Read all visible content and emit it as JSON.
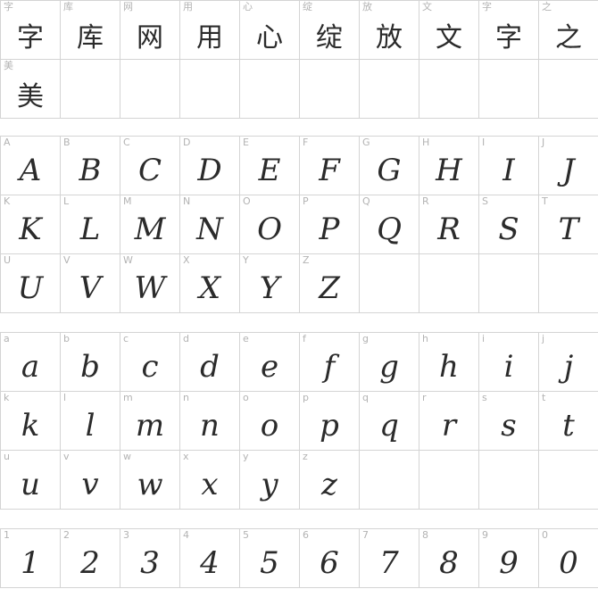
{
  "sections": {
    "cjk": [
      "字",
      "库",
      "网",
      "用",
      "心",
      "绽",
      "放",
      "文",
      "字",
      "之",
      "美"
    ],
    "upper": [
      "A",
      "B",
      "C",
      "D",
      "E",
      "F",
      "G",
      "H",
      "I",
      "J",
      "K",
      "L",
      "M",
      "N",
      "O",
      "P",
      "Q",
      "R",
      "S",
      "T",
      "U",
      "V",
      "W",
      "X",
      "Y",
      "Z"
    ],
    "lower": [
      "a",
      "b",
      "c",
      "d",
      "e",
      "f",
      "g",
      "h",
      "i",
      "j",
      "k",
      "l",
      "m",
      "n",
      "o",
      "p",
      "q",
      "r",
      "s",
      "t",
      "u",
      "v",
      "w",
      "x",
      "y",
      "z"
    ],
    "digits": [
      "1",
      "2",
      "3",
      "4",
      "5",
      "6",
      "7",
      "8",
      "9",
      "0"
    ]
  }
}
